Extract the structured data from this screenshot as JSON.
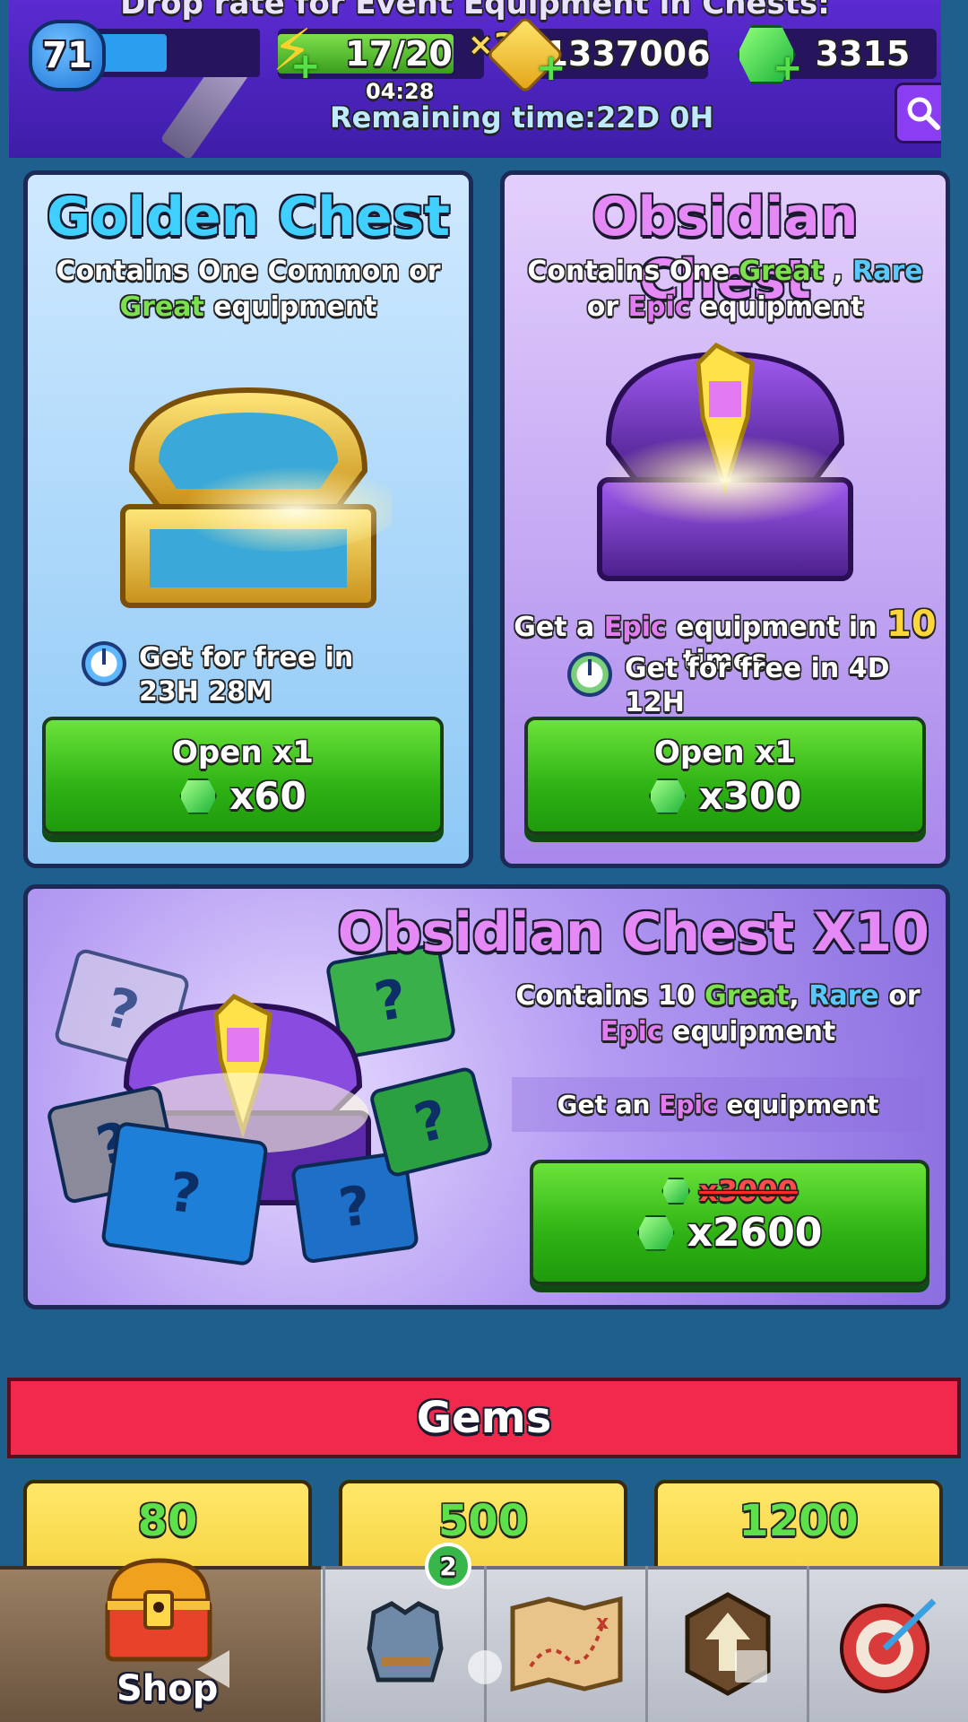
{
  "header": {
    "banner_text": "Drop rate for Event Equipment in Chests:",
    "level": "71",
    "xp_progress": 0.45,
    "energy": "17/20",
    "energy_progress": 0.85,
    "energy_timer": "04:28",
    "multiplier": "×3",
    "gold": "1337006",
    "gems": "3315",
    "remaining_time": "Remaining time:22D 0H"
  },
  "golden_chest": {
    "title": "Golden Chest",
    "desc_1a": "Contains One ",
    "desc_1b": "Common",
    "desc_1c": " or",
    "desc_2a": "Great",
    "desc_2b": " equipment",
    "free_text": "Get for free in 23H 28M",
    "button_label": "Open x1",
    "button_price": "x60"
  },
  "obsidian_chest": {
    "title": "Obsidian Chest",
    "desc_1a": "Contains One ",
    "desc_1b": "Great",
    "desc_1c": " , ",
    "desc_1d": "Rare",
    "desc_2a": "or ",
    "desc_2b": "Epic",
    "desc_2c": " equipment",
    "progress_a": "Get a ",
    "progress_b": "Epic",
    "progress_c": " equipment in ",
    "progress_n": "10",
    "progress_d": " times",
    "free_text": "Get for free in 4D 12H",
    "button_label": "Open x1",
    "button_price": "x300"
  },
  "obsidian_x10": {
    "title": "Obsidian Chest X10",
    "desc_1a": "Contains 10 ",
    "desc_1b": "Great",
    "desc_1c": ", ",
    "desc_1d": "Rare",
    "desc_1e": " or",
    "desc_2a": "Epic",
    "desc_2b": " equipment",
    "sub_a": "Get an ",
    "sub_b": "Epic",
    "sub_c": " equipment",
    "old_price": "x3000",
    "price": "x2600"
  },
  "gems_section": {
    "title": "Gems",
    "tiles": [
      "80",
      "500",
      "1200"
    ]
  },
  "bottom_nav": {
    "shop_label": "Shop",
    "equipment_badge": "2"
  },
  "colors": {
    "great": "#7ae04c",
    "rare": "#58c8ff",
    "epic": "#e07bf0",
    "button_green": "#2eb214",
    "gems_header": "#f0294d"
  }
}
